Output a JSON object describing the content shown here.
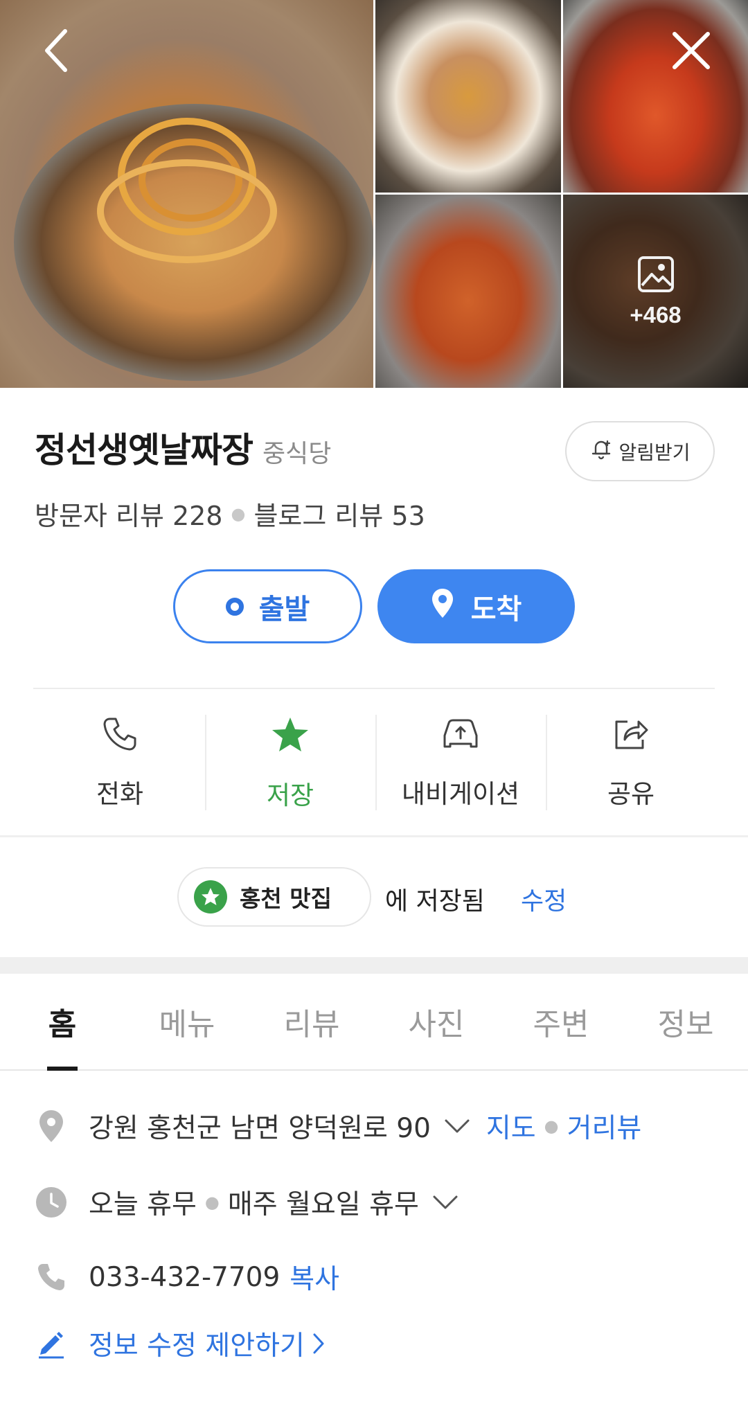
{
  "gallery": {
    "more_count": "+468",
    "icons": {
      "back": "back-arrow-icon",
      "close": "close-icon",
      "photos": "image-icon"
    }
  },
  "place": {
    "name": "정선생옛날짜장",
    "category": "중식당",
    "notify_label": "알림받기",
    "visitor_reviews": "방문자 리뷰 228",
    "blog_reviews": "블로그 리뷰 53"
  },
  "route": {
    "start_label": "출발",
    "arrive_label": "도착"
  },
  "actions": [
    {
      "label": "전화",
      "icon": "phone-icon"
    },
    {
      "label": "저장",
      "icon": "star-icon"
    },
    {
      "label": "내비게이션",
      "icon": "car-navigation-icon"
    },
    {
      "label": "공유",
      "icon": "share-icon"
    }
  ],
  "saved": {
    "list_name": "홍천 맛집",
    "suffix": "에 저장됨",
    "edit_label": "수정"
  },
  "tabs": [
    "홈",
    "메뉴",
    "리뷰",
    "사진",
    "주변",
    "정보"
  ],
  "info": {
    "address": "강원 홍천군 남면 양덕원로 90",
    "map_link": "지도",
    "roadview_link": "거리뷰",
    "hours_today": "오늘 휴무",
    "hours_weekly": "매주 월요일 휴무",
    "phone": "033-432-7709",
    "copy_label": "복사",
    "suggest_edit": "정보 수정 제안하기"
  },
  "colors": {
    "accent_blue": "#3e86f0",
    "saved_green": "#3aa24a",
    "muted_gray": "#9a9a9a"
  }
}
